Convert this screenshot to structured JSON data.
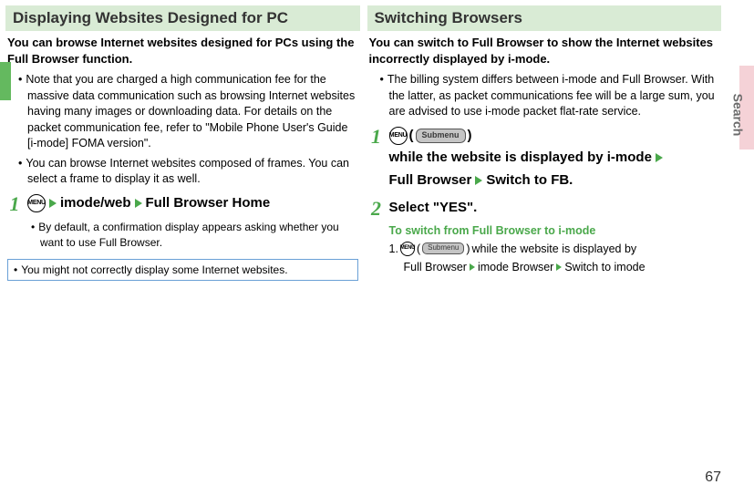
{
  "page_number": "67",
  "vertical_tab_label": "Search",
  "left": {
    "heading": "Displaying Websites Designed for PC",
    "intro": "You can browse Internet websites designed for PCs using the Full Browser function.",
    "bullets": [
      "Note that you are charged a high communication fee for the massive data communication such as browsing Internet websites having many images or downloading data. For details on the packet communication fee, refer to \"Mobile Phone User's Guide [i-mode] FOMA version\".",
      "You can browse Internet websites composed of frames. You can select a frame to display it as well."
    ],
    "step1": {
      "num": "1",
      "menu_icon": "MENU",
      "path_a": "imode/web",
      "path_b": "Full Browser Home",
      "sub_bullet": "By default, a confirmation display appears asking whether you want to use Full Browser."
    },
    "note": "You might not correctly display some Internet websites."
  },
  "right": {
    "heading": "Switching Browsers",
    "intro": "You can switch to Full Browser to show the Internet websites incorrectly displayed by i-mode.",
    "bullets": [
      "The billing system differs between i-mode and Full Browser. With the latter, as packet communications fee will be a large sum, you are advised to use i-mode packet flat-rate service."
    ],
    "step1": {
      "num": "1",
      "menu_icon": "MENU",
      "submenu_label": "Submenu",
      "seg_paren_close": ")",
      "seg_while": " while the website is displayed by i-mode",
      "seg_fb": "Full Browser",
      "seg_switch": "Switch to FB."
    },
    "step2": {
      "num": "2",
      "title": "Select \"YES\"."
    },
    "sub_heading": "To switch from Full Browser to i-mode",
    "small_step": {
      "prefix": "1. ",
      "menu_icon": "MENU",
      "submenu_label": "Submenu",
      "seg_paren_close": ")",
      "seg_while": " while the website is displayed by",
      "seg_full": "Full Browser",
      "seg_imodeb": "imode Browser",
      "seg_switch": "Switch to imode"
    }
  }
}
